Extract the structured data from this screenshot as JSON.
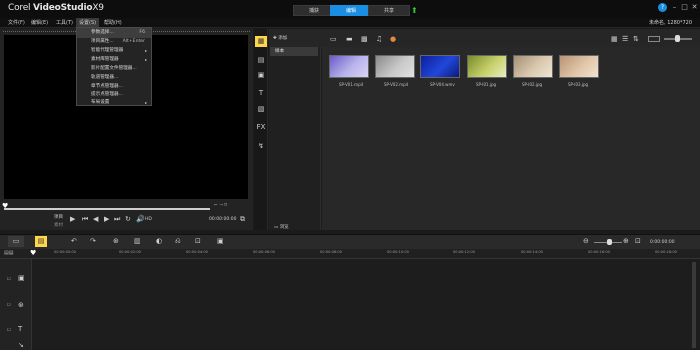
{
  "app": {
    "brand_pre": "Corel",
    "brand_name": "VideoStudio",
    "brand_ver": "X9",
    "tabs": [
      "捕获",
      "编辑",
      "共享"
    ],
    "project_info": "未命名, 1280*720"
  },
  "menubar": {
    "items": [
      "文件(F)",
      "编辑(E)",
      "工具(T)",
      "设置(S)",
      "帮助(H)"
    ]
  },
  "dropdown": {
    "items": [
      {
        "label": "参数选择...",
        "shortcut": "F6",
        "submenu": false
      },
      {
        "label": "项目属性...",
        "shortcut": "Alt+Enter",
        "submenu": false
      },
      {
        "label": "智能代理管理器",
        "shortcut": "",
        "submenu": true
      },
      {
        "label": "素材库管理器",
        "shortcut": "",
        "submenu": true
      },
      {
        "label": "影片配置文件管理器...",
        "shortcut": "",
        "submenu": false
      },
      {
        "label": "轨道管理器...",
        "shortcut": "",
        "submenu": false
      },
      {
        "label": "章节点管理器...",
        "shortcut": "",
        "submenu": false
      },
      {
        "label": "提示点管理器...",
        "shortcut": "",
        "submenu": false
      },
      {
        "label": "布局设置",
        "shortcut": "",
        "submenu": true
      }
    ]
  },
  "player": {
    "mode_top": "项目",
    "mode_bottom": "素材",
    "hd_label": "HD",
    "timecode": "00:00:00:00"
  },
  "library": {
    "add_label": "添加",
    "folder": "样本",
    "browse_label": "浏览",
    "items": [
      {
        "label": "SP-V01.mp4",
        "colors": [
          "#6a5bc7",
          "#b9b3ec",
          "#d8d6f4"
        ]
      },
      {
        "label": "SP-V02.mp4",
        "colors": [
          "#8a8a8a",
          "#c8c8c8",
          "#e2e2e2"
        ]
      },
      {
        "label": "SP-V04.wmv",
        "colors": [
          "#0b1f9e",
          "#2147d9",
          "#0a1a7a"
        ]
      },
      {
        "label": "SP-I01.jpg",
        "colors": [
          "#7a8a2a",
          "#c6d06a",
          "#e8edc4"
        ]
      },
      {
        "label": "SP-I02.jpg",
        "colors": [
          "#a39176",
          "#d9c8ad",
          "#efe5d4"
        ]
      },
      {
        "label": "SP-I03.jpg",
        "colors": [
          "#b99373",
          "#e1c6a9",
          "#f1e2d2"
        ]
      }
    ]
  },
  "timeline": {
    "timecode": "0:00:00:00",
    "ruler": [
      "00:00:00:00",
      "00:00:02:00",
      "00:00:04:00",
      "00:00:06:00",
      "00:00:08:00",
      "00:00:10:00",
      "00:00:12:00",
      "00:00:14:00",
      "00:00:16:00",
      "00:00:18:00",
      "00:00:20:00",
      "00:00:22:00"
    ]
  },
  "colors": {
    "accent": "#1a8ee0",
    "selected_tool": "#ffd54a",
    "upload_arrow": "#3cc43c"
  }
}
